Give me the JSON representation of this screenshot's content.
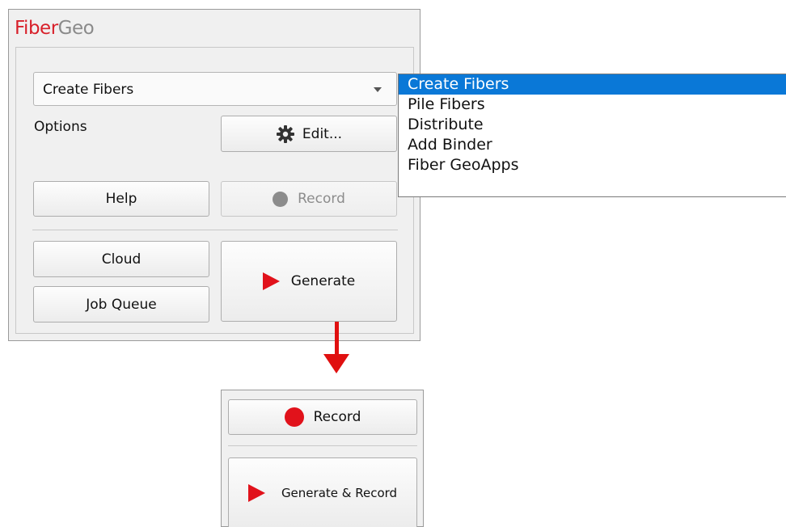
{
  "app": {
    "title_part1": "Fiber",
    "title_part2": "Geo"
  },
  "combo": {
    "selected": "Create Fibers"
  },
  "options_label": "Options",
  "buttons": {
    "edit": "Edit...",
    "help": "Help",
    "record": "Record",
    "cloud": "Cloud",
    "job_queue": "Job Queue",
    "generate": "Generate"
  },
  "dropdown": {
    "items": [
      "Create Fibers",
      "Pile Fibers",
      "Distribute",
      "Add Binder",
      "Fiber GeoApps"
    ],
    "selected_index": 0
  },
  "alt_panel": {
    "record": "Record",
    "generate_record": "Generate & Record"
  },
  "colors": {
    "accent": "#d8202a",
    "record_red": "#e1121b",
    "selection": "#0a78d7",
    "arrow": "#e01010"
  },
  "icons": {
    "edit": "gear-icon",
    "record": "record-dot-icon",
    "generate": "play-triangle-icon"
  }
}
